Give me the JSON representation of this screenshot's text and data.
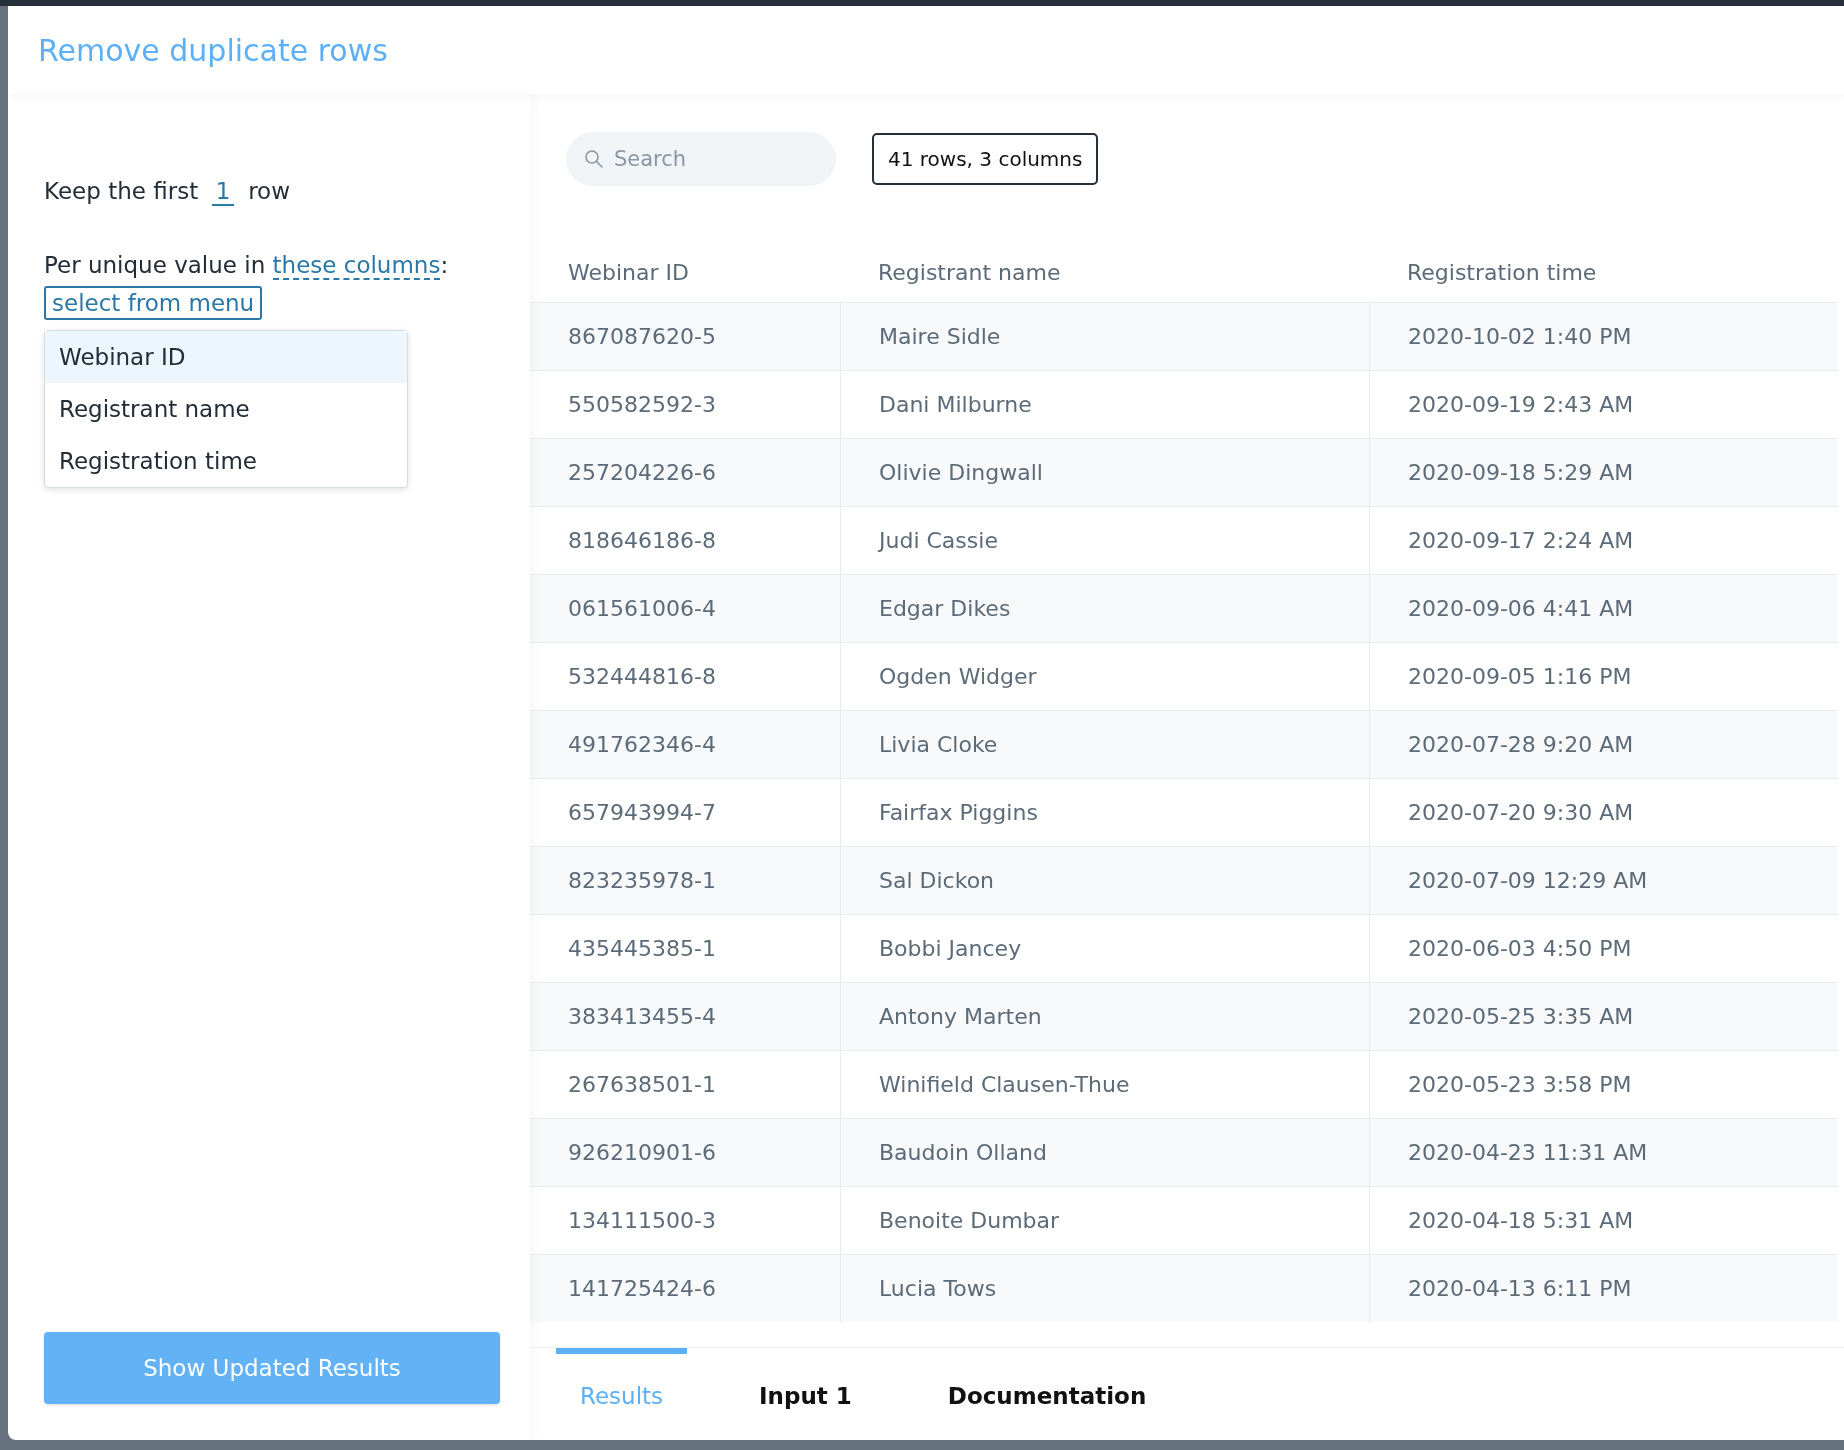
{
  "title": "Remove duplicate rows",
  "keep": {
    "prefix": "Keep the first",
    "value": "1",
    "suffix": "row"
  },
  "columns_sentence": {
    "prefix": "Per unique value in ",
    "link": "these columns",
    "suffix": ":"
  },
  "column_select": {
    "label": "select from menu",
    "menu": [
      {
        "label": "Webinar ID",
        "selected": true
      },
      {
        "label": "Registrant name",
        "selected": false
      },
      {
        "label": "Registration time",
        "selected": false
      }
    ]
  },
  "apply_button": "Show Updated Results",
  "search": {
    "placeholder": "Search"
  },
  "summary": "41 rows, 3 columns",
  "table": {
    "columns": [
      "Webinar ID",
      "Registrant name",
      "Registration time"
    ],
    "rows": [
      [
        "867087620-5",
        "Maire Sidle",
        "2020-10-02 1:40 PM"
      ],
      [
        "550582592-3",
        "Dani Milburne",
        "2020-09-19 2:43 AM"
      ],
      [
        "257204226-6",
        "Olivie Dingwall",
        "2020-09-18 5:29 AM"
      ],
      [
        "818646186-8",
        "Judi Cassie",
        "2020-09-17 2:24 AM"
      ],
      [
        "061561006-4",
        "Edgar Dikes",
        "2020-09-06 4:41 AM"
      ],
      [
        "532444816-8",
        "Ogden Widger",
        "2020-09-05 1:16 PM"
      ],
      [
        "491762346-4",
        "Livia Cloke",
        "2020-07-28 9:20 AM"
      ],
      [
        "657943994-7",
        "Fairfax Piggins",
        "2020-07-20 9:30 AM"
      ],
      [
        "823235978-1",
        "Sal Dickon",
        "2020-07-09 12:29 AM"
      ],
      [
        "435445385-1",
        "Bobbi Jancey",
        "2020-06-03 4:50 PM"
      ],
      [
        "383413455-4",
        "Antony Marten",
        "2020-05-25 3:35 AM"
      ],
      [
        "267638501-1",
        "Winifield Clausen-Thue",
        "2020-05-23 3:58 PM"
      ],
      [
        "926210901-6",
        "Baudoin Olland",
        "2020-04-23 11:31 AM"
      ],
      [
        "134111500-3",
        "Benoite Dumbar",
        "2020-04-18 5:31 AM"
      ],
      [
        "141725424-6",
        "Lucia Tows",
        "2020-04-13 6:11 PM"
      ]
    ]
  },
  "tabs": [
    {
      "label": "Results",
      "selected": true
    },
    {
      "label": "Input 1",
      "selected": false
    },
    {
      "label": "Documentation",
      "selected": false
    }
  ]
}
